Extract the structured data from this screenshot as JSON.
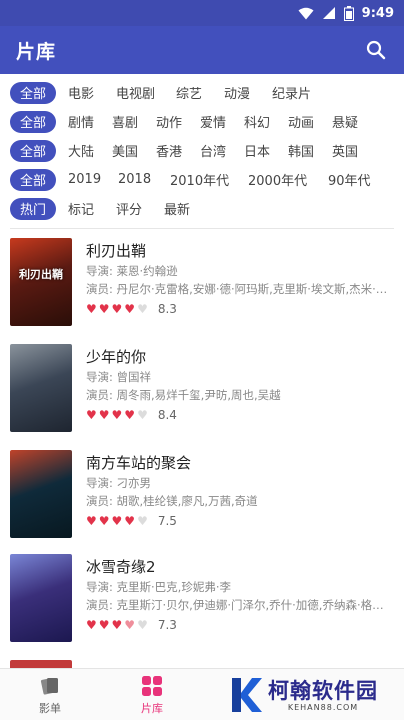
{
  "status_bar": {
    "time": "9:49"
  },
  "app_bar": {
    "title": "片库"
  },
  "filters": [
    {
      "chip": "全部",
      "options": [
        "电影",
        "电视剧",
        "综艺",
        "动漫",
        "纪录片"
      ]
    },
    {
      "chip": "全部",
      "options": [
        "剧情",
        "喜剧",
        "动作",
        "爱情",
        "科幻",
        "动画",
        "悬疑"
      ]
    },
    {
      "chip": "全部",
      "options": [
        "大陆",
        "美国",
        "香港",
        "台湾",
        "日本",
        "韩国",
        "英国"
      ]
    },
    {
      "chip": "全部",
      "options": [
        "2019",
        "2018",
        "2010年代",
        "2000年代",
        "90年代"
      ]
    },
    {
      "chip": "热门",
      "options": [
        "标记",
        "评分",
        "最新"
      ]
    }
  ],
  "movies": [
    {
      "title": "利刃出鞘",
      "director": "导演: 莱恩·约翰逊",
      "cast": "演员: 丹尼尔·克雷格,安娜·德·阿玛斯,克里斯·埃文斯,杰米·李...",
      "hearts": 4,
      "score": "8.3",
      "poster_text": "利刃出鞘",
      "poster_colors": [
        "#5a1a12",
        "#c73a1e",
        "#2a0e08"
      ]
    },
    {
      "title": "少年的你",
      "director": "导演: 曾国祥",
      "cast": "演员: 周冬雨,易烊千玺,尹昉,周也,吴越",
      "hearts": 4,
      "score": "8.4",
      "poster_text": "",
      "poster_colors": [
        "#3b4656",
        "#8a939c",
        "#1e2530"
      ]
    },
    {
      "title": "南方车站的聚会",
      "director": "导演: 刁亦男",
      "cast": "演员: 胡歌,桂纶镁,廖凡,万茜,奇道",
      "hearts": 4,
      "score": "7.5",
      "poster_text": "",
      "poster_colors": [
        "#0f2a3a",
        "#c0432a",
        "#081820"
      ]
    },
    {
      "title": "冰雪奇缘2",
      "director": "导演: 克里斯·巴克,珍妮弗·李",
      "cast": "演员: 克里斯汀·贝尔,伊迪娜·门泽尔,乔什·加德,乔纳森·格罗...",
      "hearts": 3.5,
      "score": "7.3",
      "poster_text": "",
      "poster_colors": [
        "#3a2f7a",
        "#7a86d6",
        "#1c1850"
      ]
    }
  ],
  "bottom_nav": [
    {
      "label": "影单",
      "icon": "cards-icon",
      "active": false
    },
    {
      "label": "片库",
      "icon": "grid-icon",
      "active": true
    }
  ],
  "watermark": {
    "main": "柯翰软件园",
    "sub": "KEHAN88.COM"
  },
  "colors": {
    "primary": "#4250bd",
    "status": "#3f4bb0",
    "accent_pink": "#e8337a",
    "heart": "#e2334a"
  }
}
